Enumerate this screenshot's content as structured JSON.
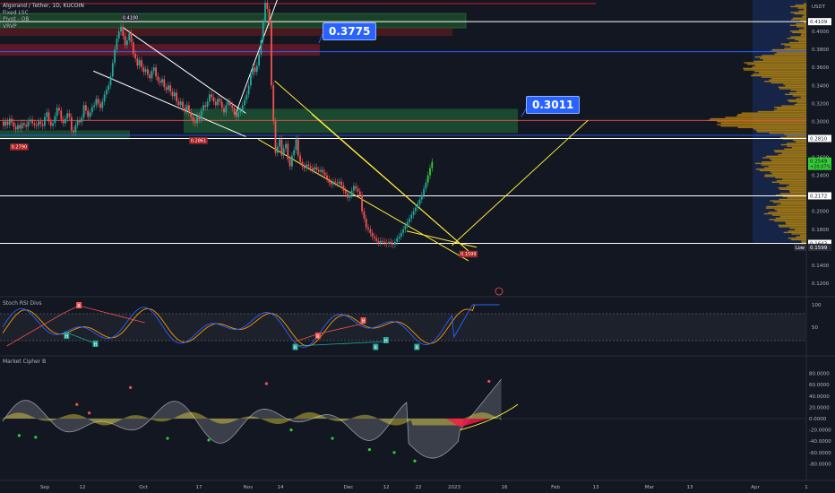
{
  "header": {
    "symbol": "Algorand / Tether, 1D, KUCOIN",
    "indicators": [
      "Fixed LSC",
      "Pivot - OB",
      "VRVP"
    ]
  },
  "colors": {
    "background": "#131722",
    "up": "#26a69a",
    "down": "#ef5350",
    "bull_bright": "#33cc33",
    "trend": "#ffeb3b",
    "level": "#ffffff",
    "callout": "#2962ff",
    "stoch_k": "#2962ff",
    "stoch_d": "#ff9800",
    "wave": "#787b86",
    "money_flow_pos": "#ffeb3b",
    "money_flow_neg": "#ff1744"
  },
  "price_pane": {
    "currency": "USDT",
    "y_ticks": [
      "0.4000",
      "0.3800",
      "0.3600",
      "0.3400",
      "0.3200",
      "0.3000",
      "0.2600",
      "0.2400",
      "0.2000",
      "0.1800",
      "0.1400",
      "0.1200"
    ],
    "ylim": [
      0.11,
      0.43
    ],
    "axis_labels": [
      {
        "text": "0.4109",
        "value": 0.4109,
        "bg": "#ffffff",
        "fg": "#131722"
      },
      {
        "text": "0.2810",
        "value": 0.281,
        "bg": "#ffffff",
        "fg": "#131722"
      },
      {
        "text": "0.2172",
        "value": 0.2172,
        "bg": "#ffffff",
        "fg": "#131722"
      },
      {
        "text": "0.1643",
        "value": 0.1643,
        "bg": "#ffffff",
        "fg": "#131722"
      },
      {
        "text": "0.1599",
        "value": 0.1599,
        "bg": "#2a2e39",
        "fg": "#ffffff"
      }
    ],
    "low_label": "Low",
    "price_tag": {
      "text": "0.2549",
      "sub": "+20.07%",
      "value": 0.2549,
      "bg": "#33cc33",
      "fg": "#131722"
    },
    "pivot_labels": [
      {
        "text": "0.4100",
        "value": 0.41,
        "day": 62
      },
      {
        "text": "0.2790",
        "value": 0.279,
        "day": 8
      },
      {
        "text": "0.2861",
        "value": 0.2861,
        "day": 95
      },
      {
        "text": "0.1599",
        "value": 0.1599,
        "day": 226
      }
    ],
    "callouts": [
      {
        "text": "0.3775",
        "value": 0.3775
      },
      {
        "text": "0.3011",
        "value": 0.3011
      }
    ],
    "levels": [
      0.4109,
      0.3775,
      0.3011,
      0.281,
      0.2172,
      0.1643
    ]
  },
  "stoch_pane": {
    "title": "Stoch RSI Divs",
    "y_ticks": [
      "100",
      "50",
      "0"
    ],
    "marker_hidden_bull": "H",
    "marker_regular_bull": "R"
  },
  "cipher_pane": {
    "title": "Market Cipher B",
    "y_ticks": [
      "80.0000",
      "60.0000",
      "40.0000",
      "20.0000",
      "0.0000",
      "-20.0000",
      "-40.0000",
      "-60.0000",
      "-80.0000"
    ]
  },
  "x_axis": {
    "labels": [
      "Sep",
      "12",
      "Oct",
      "17",
      "Nov",
      "14",
      "Dec",
      "12",
      "22",
      "2023",
      "16",
      "Feb",
      "13",
      "Mar",
      "13",
      "Apr",
      "1"
    ]
  },
  "chart_data": {
    "type": "candlestick",
    "title": "Algorand / Tether, 1D, KUCOIN",
    "xlabel": "",
    "ylabel": "USDT",
    "x_unit": "days from Aug 20, 2022",
    "ylim": [
      0.11,
      0.43
    ],
    "candles": [
      [
        0.3,
        0.295
      ],
      [
        0.295,
        0.3
      ],
      [
        0.3,
        0.296
      ],
      [
        0.296,
        0.303
      ],
      [
        0.303,
        0.299
      ],
      [
        0.299,
        0.294
      ],
      [
        0.294,
        0.291
      ],
      [
        0.291,
        0.296
      ],
      [
        0.296,
        0.292
      ],
      [
        0.292,
        0.298
      ],
      [
        0.298,
        0.296
      ],
      [
        0.296,
        0.294
      ],
      [
        0.294,
        0.3
      ],
      [
        0.3,
        0.302
      ],
      [
        0.302,
        0.298
      ],
      [
        0.298,
        0.296
      ],
      [
        0.296,
        0.295
      ],
      [
        0.295,
        0.3
      ],
      [
        0.3,
        0.297
      ],
      [
        0.297,
        0.295
      ],
      [
        0.295,
        0.305
      ],
      [
        0.305,
        0.31
      ],
      [
        0.31,
        0.3
      ],
      [
        0.3,
        0.295
      ],
      [
        0.295,
        0.298
      ],
      [
        0.298,
        0.306
      ],
      [
        0.306,
        0.315
      ],
      [
        0.315,
        0.312
      ],
      [
        0.312,
        0.302
      ],
      [
        0.302,
        0.298
      ],
      [
        0.298,
        0.303
      ],
      [
        0.303,
        0.309
      ],
      [
        0.309,
        0.305
      ],
      [
        0.305,
        0.29
      ],
      [
        0.29,
        0.288
      ],
      [
        0.288,
        0.296
      ],
      [
        0.296,
        0.301
      ],
      [
        0.301,
        0.299
      ],
      [
        0.299,
        0.304
      ],
      [
        0.304,
        0.318
      ],
      [
        0.318,
        0.312
      ],
      [
        0.312,
        0.305
      ],
      [
        0.305,
        0.31
      ],
      [
        0.31,
        0.316
      ],
      [
        0.316,
        0.318
      ],
      [
        0.318,
        0.325
      ],
      [
        0.325,
        0.32
      ],
      [
        0.32,
        0.315
      ],
      [
        0.315,
        0.322
      ],
      [
        0.322,
        0.33
      ],
      [
        0.33,
        0.335
      ],
      [
        0.335,
        0.34
      ],
      [
        0.34,
        0.35
      ],
      [
        0.35,
        0.365
      ],
      [
        0.365,
        0.38
      ],
      [
        0.38,
        0.392
      ],
      [
        0.392,
        0.4
      ],
      [
        0.4,
        0.405
      ],
      [
        0.405,
        0.395
      ],
      [
        0.395,
        0.385
      ],
      [
        0.385,
        0.39
      ],
      [
        0.39,
        0.398
      ],
      [
        0.398,
        0.388
      ],
      [
        0.388,
        0.375
      ],
      [
        0.375,
        0.37
      ],
      [
        0.37,
        0.362
      ],
      [
        0.362,
        0.368
      ],
      [
        0.368,
        0.36
      ],
      [
        0.36,
        0.355
      ],
      [
        0.355,
        0.358
      ],
      [
        0.358,
        0.352
      ],
      [
        0.352,
        0.348
      ],
      [
        0.348,
        0.356
      ],
      [
        0.356,
        0.36
      ],
      [
        0.36,
        0.35
      ],
      [
        0.35,
        0.345
      ],
      [
        0.345,
        0.343
      ],
      [
        0.343,
        0.347
      ],
      [
        0.347,
        0.338
      ],
      [
        0.338,
        0.335
      ],
      [
        0.335,
        0.34
      ],
      [
        0.34,
        0.333
      ],
      [
        0.333,
        0.328
      ],
      [
        0.328,
        0.332
      ],
      [
        0.332,
        0.322
      ],
      [
        0.322,
        0.318
      ],
      [
        0.318,
        0.322
      ],
      [
        0.322,
        0.315
      ],
      [
        0.315,
        0.312
      ],
      [
        0.312,
        0.318
      ],
      [
        0.318,
        0.31
      ],
      [
        0.31,
        0.305
      ],
      [
        0.305,
        0.3
      ],
      [
        0.3,
        0.298
      ],
      [
        0.298,
        0.306
      ],
      [
        0.306,
        0.302
      ],
      [
        0.302,
        0.312
      ],
      [
        0.312,
        0.318
      ],
      [
        0.318,
        0.316
      ],
      [
        0.316,
        0.322
      ],
      [
        0.322,
        0.33
      ],
      [
        0.33,
        0.327
      ],
      [
        0.327,
        0.322
      ],
      [
        0.322,
        0.318
      ],
      [
        0.318,
        0.325
      ],
      [
        0.325,
        0.322
      ],
      [
        0.322,
        0.315
      ],
      [
        0.315,
        0.31
      ],
      [
        0.31,
        0.318
      ],
      [
        0.318,
        0.322
      ],
      [
        0.322,
        0.318
      ],
      [
        0.318,
        0.315
      ],
      [
        0.315,
        0.308
      ],
      [
        0.308,
        0.305
      ],
      [
        0.305,
        0.31
      ],
      [
        0.31,
        0.312
      ],
      [
        0.312,
        0.318
      ],
      [
        0.318,
        0.324
      ],
      [
        0.324,
        0.33
      ],
      [
        0.33,
        0.34
      ],
      [
        0.34,
        0.352
      ],
      [
        0.352,
        0.36
      ],
      [
        0.36,
        0.355
      ],
      [
        0.355,
        0.362
      ],
      [
        0.362,
        0.375
      ],
      [
        0.375,
        0.39
      ],
      [
        0.39,
        0.41
      ],
      [
        0.41,
        0.432
      ],
      [
        0.432,
        0.425
      ],
      [
        0.425,
        0.41
      ],
      [
        0.41,
        0.34
      ],
      [
        0.34,
        0.3
      ],
      [
        0.3,
        0.265
      ],
      [
        0.265,
        0.272
      ],
      [
        0.272,
        0.28
      ],
      [
        0.28,
        0.262
      ],
      [
        0.262,
        0.27
      ],
      [
        0.27,
        0.275
      ],
      [
        0.275,
        0.258
      ],
      [
        0.258,
        0.25
      ],
      [
        0.25,
        0.262
      ],
      [
        0.262,
        0.268
      ],
      [
        0.268,
        0.28
      ],
      [
        0.28,
        0.262
      ],
      [
        0.262,
        0.255
      ],
      [
        0.255,
        0.25
      ],
      [
        0.25,
        0.248
      ],
      [
        0.248,
        0.252
      ],
      [
        0.252,
        0.25
      ],
      [
        0.25,
        0.248
      ],
      [
        0.248,
        0.246
      ],
      [
        0.246,
        0.249
      ],
      [
        0.249,
        0.246
      ],
      [
        0.246,
        0.244
      ],
      [
        0.244,
        0.246
      ],
      [
        0.246,
        0.243
      ],
      [
        0.243,
        0.24
      ],
      [
        0.24,
        0.236
      ],
      [
        0.236,
        0.232
      ],
      [
        0.232,
        0.23
      ],
      [
        0.23,
        0.233
      ],
      [
        0.233,
        0.232
      ],
      [
        0.232,
        0.231
      ],
      [
        0.231,
        0.233
      ],
      [
        0.233,
        0.229
      ],
      [
        0.229,
        0.223
      ],
      [
        0.223,
        0.22
      ],
      [
        0.22,
        0.215
      ],
      [
        0.215,
        0.218
      ],
      [
        0.218,
        0.223
      ],
      [
        0.223,
        0.228
      ],
      [
        0.228,
        0.225
      ],
      [
        0.225,
        0.222
      ],
      [
        0.222,
        0.218
      ],
      [
        0.218,
        0.2
      ],
      [
        0.2,
        0.192
      ],
      [
        0.192,
        0.182
      ],
      [
        0.182,
        0.18
      ],
      [
        0.18,
        0.176
      ],
      [
        0.176,
        0.172
      ],
      [
        0.172,
        0.17
      ],
      [
        0.17,
        0.167
      ],
      [
        0.167,
        0.165
      ],
      [
        0.165,
        0.167
      ],
      [
        0.167,
        0.166
      ],
      [
        0.166,
        0.165
      ],
      [
        0.165,
        0.164
      ],
      [
        0.164,
        0.166
      ],
      [
        0.166,
        0.164
      ],
      [
        0.164,
        0.163
      ],
      [
        0.163,
        0.166
      ],
      [
        0.166,
        0.17
      ],
      [
        0.17,
        0.172
      ],
      [
        0.172,
        0.176
      ],
      [
        0.176,
        0.18
      ],
      [
        0.18,
        0.184
      ],
      [
        0.184,
        0.188
      ],
      [
        0.188,
        0.192
      ],
      [
        0.192,
        0.196
      ],
      [
        0.196,
        0.2
      ],
      [
        0.2,
        0.204
      ],
      [
        0.204,
        0.208
      ],
      [
        0.208,
        0.213
      ],
      [
        0.213,
        0.218
      ],
      [
        0.218,
        0.225
      ],
      [
        0.225,
        0.232
      ],
      [
        0.232,
        0.24
      ],
      [
        0.24,
        0.248
      ],
      [
        0.248,
        0.2549
      ]
    ]
  }
}
